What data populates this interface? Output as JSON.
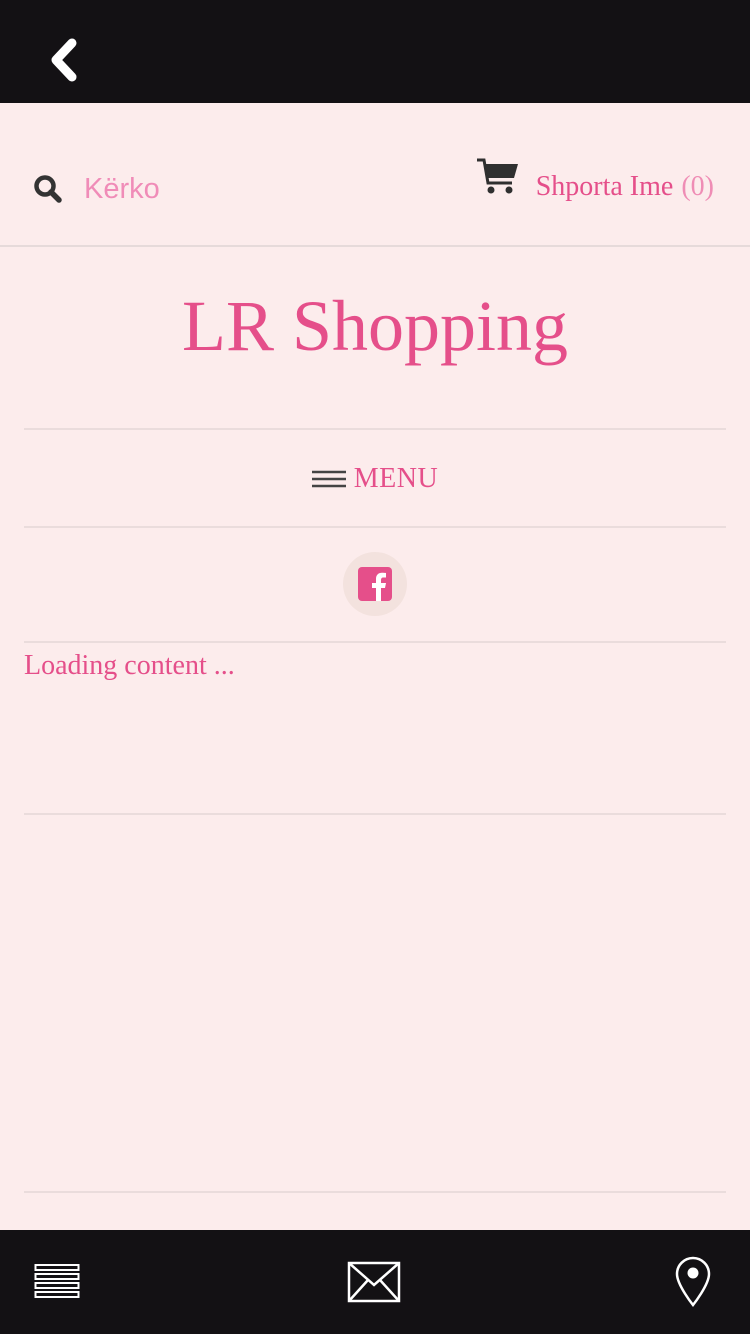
{
  "top_bar": {
    "back_icon": "chevron-left-icon"
  },
  "header": {
    "search": {
      "placeholder": "Kërko",
      "value": "",
      "icon": "search-icon"
    },
    "cart": {
      "label": "Shporta Ime",
      "count": "(0)",
      "icon": "shopping-cart-icon"
    }
  },
  "brand": {
    "title": "LR Shopping"
  },
  "menu": {
    "label": "MENU",
    "icon": "hamburger-icon"
  },
  "social": {
    "icon": "facebook-icon"
  },
  "content": {
    "loading_text": "Loading content ..."
  },
  "bottom_bar": {
    "icons": [
      "list-icon",
      "mail-icon",
      "location-pin-icon"
    ]
  },
  "colors": {
    "accent": "#e54f8a",
    "background": "#fcecec",
    "bar": "#131114",
    "placeholder": "#f08cb8"
  }
}
